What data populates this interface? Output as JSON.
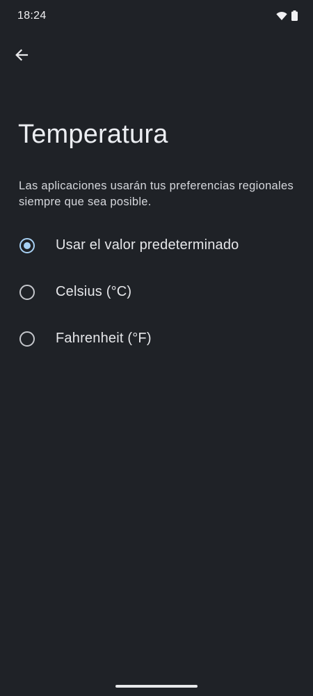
{
  "status_bar": {
    "time": "18:24",
    "icons": [
      "wifi-icon",
      "battery-icon"
    ]
  },
  "header": {
    "back_icon": "arrow-back-icon"
  },
  "page": {
    "title": "Temperatura",
    "description": "Las aplicaciones usarán tus preferencias regionales siempre que sea posible."
  },
  "options": [
    {
      "label": "Usar el valor predeterminado",
      "selected": true
    },
    {
      "label": "Celsius (°C)",
      "selected": false
    },
    {
      "label": "Fahrenheit (°F)",
      "selected": false
    }
  ],
  "colors": {
    "background": "#1f2227",
    "accent": "#a8d1f4",
    "text_primary": "#e6e7ea"
  }
}
